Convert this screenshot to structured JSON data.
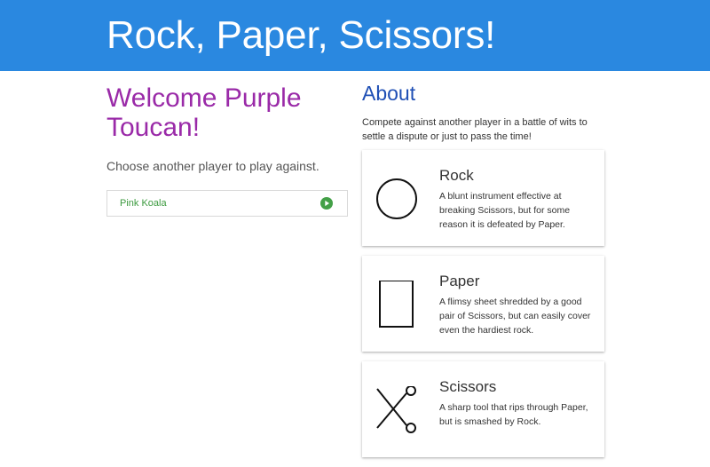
{
  "header": {
    "title": "Rock, Paper, Scissors!",
    "color": "#2a88e0"
  },
  "welcome": {
    "title": "Welcome Purple Toucan!",
    "subtitle": "Choose another player to play against."
  },
  "players": [
    {
      "name": "Pink Koala",
      "action_icon": "play-icon"
    }
  ],
  "about": {
    "title": "About",
    "text": "Compete against another player in a battle of wits to settle a dispute or just to pass the time!",
    "cards": [
      {
        "name": "Rock",
        "icon": "circle-icon",
        "description": "A blunt instrument effective at breaking Scissors, but for some reason it is defeated by Paper."
      },
      {
        "name": "Paper",
        "icon": "rectangle-icon",
        "description": "A flimsy sheet shredded by a good pair of Scissors, but can easily cover even the hardiest rock."
      },
      {
        "name": "Scissors",
        "icon": "scissors-icon",
        "description": "A sharp tool that rips through Paper, but is smashed by Rock."
      }
    ]
  },
  "colors": {
    "welcome": "#9a2aa8",
    "about": "#1f4fb5",
    "player": "#3c9a3f"
  }
}
